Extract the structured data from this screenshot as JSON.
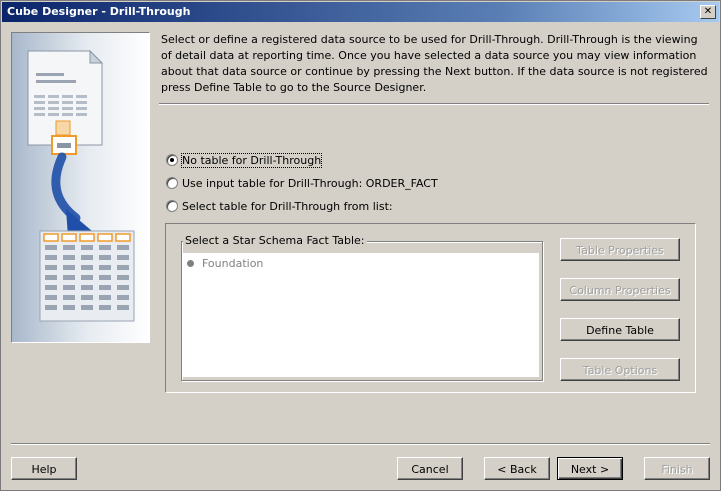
{
  "window": {
    "title": "Cube Designer - Drill-Through",
    "close_glyph": "✕"
  },
  "description": "Select or define a registered data source to be used for Drill-Through. Drill-Through is the viewing of detail data at reporting time. Once you have selected a data source you may view information about that data source or continue by pressing the Next button. If the data source is not registered press Define Table to go to the Source Designer.",
  "options": [
    {
      "label": "No table for Drill-Through",
      "checked": true
    },
    {
      "label": "Use input table for Drill-Through: ORDER_FACT",
      "checked": false
    },
    {
      "label": "Select table for Drill-Through from list:",
      "checked": false
    }
  ],
  "star_schema": {
    "legend": "Select a Star Schema Fact Table:",
    "items": [
      "Foundation"
    ]
  },
  "side_buttons": {
    "table_properties": "Table Properties",
    "column_properties": "Column Properties",
    "define_table": "Define Table",
    "table_options": "Table Options"
  },
  "footer": {
    "help": "Help",
    "cancel": "Cancel",
    "back": "< Back",
    "next": "Next >",
    "finish": "Finish"
  },
  "colors": {
    "title_bar": "#0a246a",
    "dialog_bg": "#d4d0c8",
    "illustration_arrow": "#1f4fa8",
    "illustration_highlight": "#f09a2a"
  },
  "icons": {
    "side_illustration": "report-to-table-illustration-icon"
  }
}
